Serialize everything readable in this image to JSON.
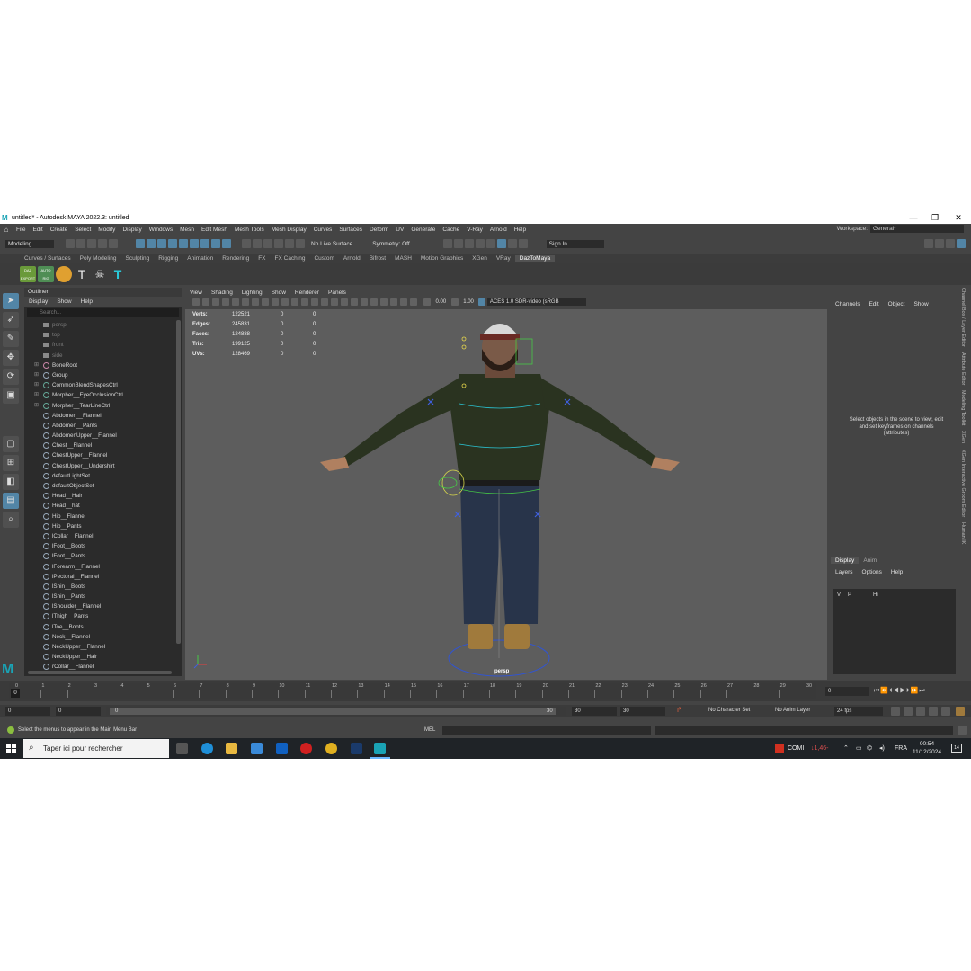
{
  "window": {
    "title": "untitled* - Autodesk MAYA 2022.3: untitled",
    "controls": [
      "—",
      "❐",
      "✕"
    ]
  },
  "menubar": {
    "items": [
      "File",
      "Edit",
      "Create",
      "Select",
      "Modify",
      "Display",
      "Windows",
      "Mesh",
      "Edit Mesh",
      "Mesh Tools",
      "Mesh Display",
      "Curves",
      "Surfaces",
      "Deform",
      "UV",
      "Generate",
      "Cache",
      "V-Ray",
      "Arnold",
      "Help"
    ],
    "workspace_label": "Workspace:",
    "workspace_value": "General*"
  },
  "statusline": {
    "mode": "Modeling",
    "live_surface": "No Live Surface",
    "symmetry": "Symmetry: Off",
    "sign_in": "Sign In"
  },
  "shelf": {
    "tabs": [
      "Curves / Surfaces",
      "Poly Modeling",
      "Sculpting",
      "Rigging",
      "Animation",
      "Rendering",
      "FX",
      "FX Caching",
      "Custom",
      "Arnold",
      "Bifrost",
      "MASH",
      "Motion Graphics",
      "XGen",
      "VRay",
      "DazToMaya"
    ],
    "active_tab": "DazToMaya",
    "icon_labels": [
      "DAZ EXPORT",
      "AUTO RIG"
    ]
  },
  "outliner": {
    "title": "Outliner",
    "menu": [
      "Display",
      "Show",
      "Help"
    ],
    "search_placeholder": "Search...",
    "items": [
      {
        "label": "persp",
        "kind": "camera",
        "dim": true
      },
      {
        "label": "top",
        "kind": "camera",
        "dim": true
      },
      {
        "label": "front",
        "kind": "camera",
        "dim": true
      },
      {
        "label": "side",
        "kind": "camera",
        "dim": true
      },
      {
        "label": "BoneRoot",
        "kind": "joint",
        "expand": true
      },
      {
        "label": "Group",
        "kind": "group",
        "expand": true
      },
      {
        "label": "CommonBlendShapesCtrl",
        "kind": "curve",
        "expand": true
      },
      {
        "label": "Morpher__EyeOcclusionCtrl",
        "kind": "curve",
        "expand": true
      },
      {
        "label": "Morpher__TearLineCtrl",
        "kind": "curve",
        "expand": true
      },
      {
        "label": "Abdomen__Flannel",
        "kind": "set"
      },
      {
        "label": "Abdomen__Pants",
        "kind": "set"
      },
      {
        "label": "AbdomenUpper__Flannel",
        "kind": "set"
      },
      {
        "label": "Chest__Flannel",
        "kind": "set"
      },
      {
        "label": "ChestUpper__Flannel",
        "kind": "set"
      },
      {
        "label": "ChestUpper__Undershirt",
        "kind": "set"
      },
      {
        "label": "defaultLightSet",
        "kind": "set"
      },
      {
        "label": "defaultObjectSet",
        "kind": "set"
      },
      {
        "label": "Head__Hair",
        "kind": "set"
      },
      {
        "label": "Head__hat",
        "kind": "set"
      },
      {
        "label": "Hip__Flannel",
        "kind": "set"
      },
      {
        "label": "Hip__Pants",
        "kind": "set"
      },
      {
        "label": "lCollar__Flannel",
        "kind": "set"
      },
      {
        "label": "lFoot__Boots",
        "kind": "set"
      },
      {
        "label": "lFoot__Pants",
        "kind": "set"
      },
      {
        "label": "lForearm__Flannel",
        "kind": "set"
      },
      {
        "label": "lPectoral__Flannel",
        "kind": "set"
      },
      {
        "label": "lShin__Boots",
        "kind": "set"
      },
      {
        "label": "lShin__Pants",
        "kind": "set"
      },
      {
        "label": "lShoulder__Flannel",
        "kind": "set"
      },
      {
        "label": "lThigh__Pants",
        "kind": "set"
      },
      {
        "label": "lToe__Boots",
        "kind": "set"
      },
      {
        "label": "Neck__Flannel",
        "kind": "set"
      },
      {
        "label": "NeckUpper__Flannel",
        "kind": "set"
      },
      {
        "label": "NeckUpper__Hair",
        "kind": "set"
      },
      {
        "label": "rCollar__Flannel",
        "kind": "set"
      }
    ]
  },
  "viewport": {
    "menu": [
      "View",
      "Shading",
      "Lighting",
      "Show",
      "Renderer",
      "Panels"
    ],
    "exposure": "0.00",
    "gamma": "1.00",
    "color_space": "ACES 1.0 SDR-video (sRGB",
    "camera": "persp",
    "hud": [
      {
        "label": "Verts:",
        "value": "122521",
        "a": "0",
        "b": "0"
      },
      {
        "label": "Edges:",
        "value": "245831",
        "a": "0",
        "b": "0"
      },
      {
        "label": "Faces:",
        "value": "124888",
        "a": "0",
        "b": "0"
      },
      {
        "label": "Tris:",
        "value": "199125",
        "a": "0",
        "b": "0"
      },
      {
        "label": "UVs:",
        "value": "128469",
        "a": "0",
        "b": "0"
      }
    ]
  },
  "channel_box": {
    "menu": [
      "Channels",
      "Edit",
      "Object",
      "Show"
    ],
    "hint": "Select objects in the scene to view, edit and set keyframes on channels (attributes)",
    "layer_tabs": [
      "Display",
      "Anim"
    ],
    "layer_menu": [
      "Layers",
      "Options",
      "Help"
    ],
    "layer_row": {
      "v": "V",
      "p": "P",
      "name": "Hi"
    }
  },
  "side_tabs": [
    "Channel Box / Layer Editor",
    "Attribute Editor",
    "Modeling Toolkit",
    "XGen",
    "XGen Interactive Groom Editor",
    "Human IK"
  ],
  "timeline": {
    "ticks": [
      "0",
      "1",
      "2",
      "3",
      "4",
      "5",
      "6",
      "7",
      "8",
      "9",
      "10",
      "11",
      "12",
      "13",
      "14",
      "15",
      "16",
      "17",
      "18",
      "19",
      "20",
      "21",
      "22",
      "23",
      "24",
      "25",
      "26",
      "27",
      "28",
      "29",
      "30"
    ],
    "current_frame": "0"
  },
  "range": {
    "start": "0",
    "start_inner": "0",
    "slider_start": "0",
    "slider_end": "30",
    "end_inner": "30",
    "end": "30",
    "character_set": "No Character Set",
    "anim_layer": "No Anim Layer",
    "fps": "24 fps"
  },
  "command_line": {
    "help": "Select the menus to appear in the Main Menu Bar",
    "lang": "MEL"
  },
  "taskbar": {
    "search": "Taper ici pour rechercher",
    "stock_name": "COMI",
    "stock_change": "↓1,46-",
    "lang": "FRA",
    "time": "00:54",
    "date": "11/12/2024",
    "notifications": "14"
  },
  "colors": {
    "accent": "#5285a6",
    "maya_logo": "#1aa3b5",
    "active_tab": "#525252"
  }
}
